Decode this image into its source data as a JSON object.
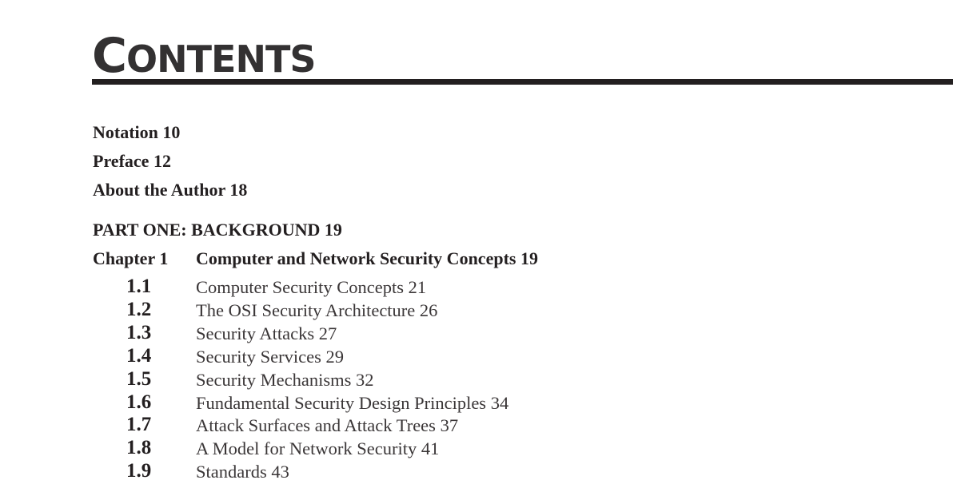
{
  "heading": {
    "first_letter": "C",
    "rest": "ONTENTS"
  },
  "front_matter": [
    {
      "label": "Notation",
      "page": "10"
    },
    {
      "label": "Preface",
      "page": "12"
    },
    {
      "label": "About the Author",
      "page": "18"
    }
  ],
  "part": {
    "label": "PART ONE: BACKGROUND",
    "page": "19"
  },
  "chapter": {
    "label": "Chapter 1",
    "title": "Computer and Network Security Concepts",
    "page": "19"
  },
  "sections": [
    {
      "number": "1.1",
      "title": "Computer Security Concepts",
      "page": "21"
    },
    {
      "number": "1.2",
      "title": "The OSI Security Architecture",
      "page": "26"
    },
    {
      "number": "1.3",
      "title": "Security Attacks",
      "page": "27"
    },
    {
      "number": "1.4",
      "title": "Security Services",
      "page": "29"
    },
    {
      "number": "1.5",
      "title": "Security Mechanisms",
      "page": "32"
    },
    {
      "number": "1.6",
      "title": "Fundamental Security Design Principles",
      "page": "34"
    },
    {
      "number": "1.7",
      "title": "Attack Surfaces and Attack Trees",
      "page": "37"
    },
    {
      "number": "1.8",
      "title": "A Model for Network Security",
      "page": "41"
    },
    {
      "number": "1.9",
      "title": "Standards",
      "page": "43"
    }
  ]
}
